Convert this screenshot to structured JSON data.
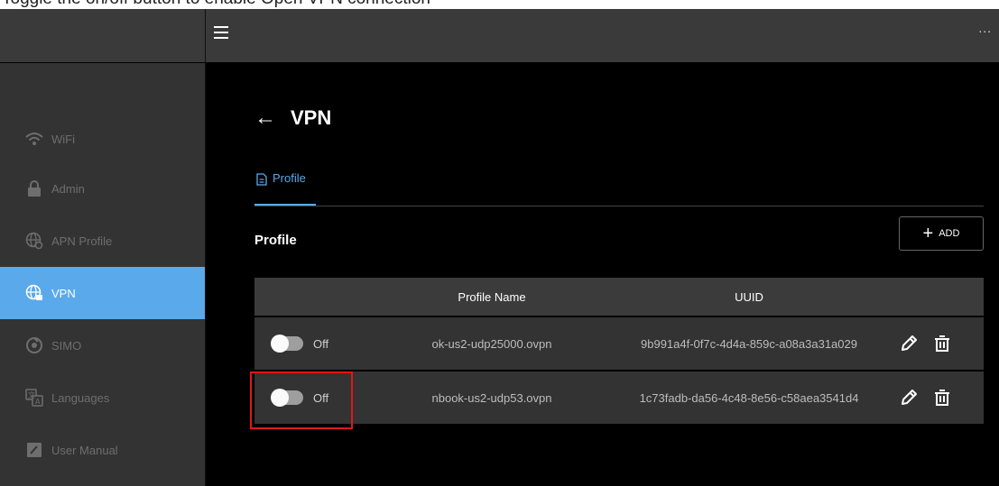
{
  "caption": "Toggle the on/off button to enable Open VPN connection",
  "topbar": {
    "more_label": "..."
  },
  "sidebar": {
    "items": [
      {
        "label": "WiFi",
        "icon": "wifi-icon",
        "active": false
      },
      {
        "label": "Admin",
        "icon": "lock-icon",
        "active": false
      },
      {
        "label": "APN Profile",
        "icon": "apn-globe-icon",
        "active": false
      },
      {
        "label": "VPN",
        "icon": "vpn-globe-icon",
        "active": true
      },
      {
        "label": "SIMO",
        "icon": "simo-icon",
        "active": false
      },
      {
        "label": "Languages",
        "icon": "translate-icon",
        "active": false
      },
      {
        "label": "User Manual",
        "icon": "manual-icon",
        "active": false
      }
    ]
  },
  "page": {
    "back_label": "←",
    "title": "VPN",
    "tab_label": "Profile",
    "section_title": "Profile",
    "add_label": "ADD"
  },
  "table": {
    "headers": {
      "name": "Profile Name",
      "uuid": "UUID"
    },
    "rows": [
      {
        "toggle": "Off",
        "name": "ok-us2-udp25000.ovpn",
        "uuid": "9b991a4f-0f7c-4d4a-859c-a08a3a31a029"
      },
      {
        "toggle": "Off",
        "name": "nbook-us2-udp53.ovpn",
        "uuid": "1c73fadb-da56-4c48-8e56-c58aea3541d4"
      }
    ]
  },
  "colors": {
    "accent": "#5aa9ea",
    "highlight": "#e0161b",
    "background": "#000000",
    "sidebar": "#333333"
  }
}
